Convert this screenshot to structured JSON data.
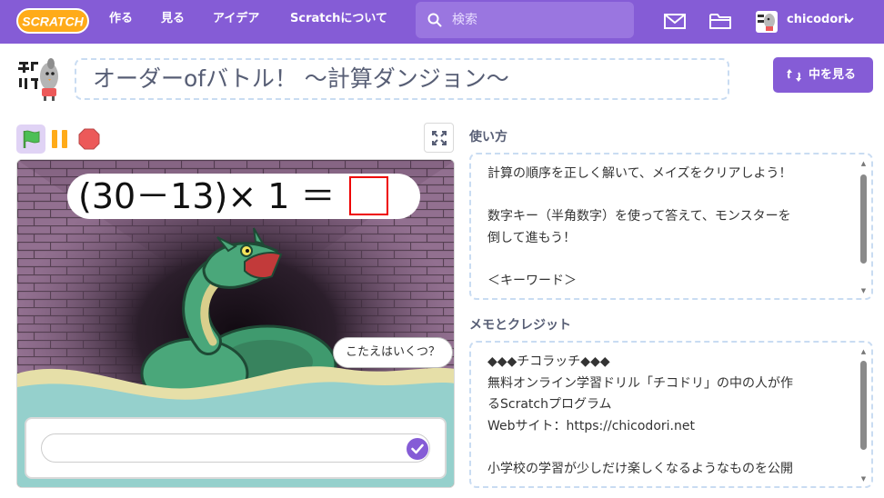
{
  "nav": {
    "logo_text": "SCRATCH",
    "create": "作る",
    "explore": "見る",
    "ideas": "アイデア",
    "about": "Scratchについて",
    "search_placeholder": "検索",
    "user_name": "chicodori",
    "icons": [
      "search-icon",
      "mail-icon",
      "folder-icon",
      "chevron-down-icon"
    ]
  },
  "project": {
    "title": "オーダーofバトル！ ～計算ダンジョン～",
    "see_inside_label": "中を見る",
    "avatar_text": "チコドリ"
  },
  "stage": {
    "equation": "(30－13)× 1 ＝",
    "speech_bubble": "こたえはいくつ？",
    "answer_input_value": ""
  },
  "instructions": {
    "heading": "使い方",
    "text": "計算の順序を正しく解いて、メイズをクリアしよう！\n\n数字キー（半角数字）を使って答えて、モンスターを\n倒して進もう！\n\n＜キーワード＞"
  },
  "notes": {
    "heading": "メモとクレジット",
    "text": "◆◆◆チコラッチ◆◆◆\n無料オンライン学習ドリル「チコドリ」の中の人が作\nるScratchプログラム\nWebサイト：https://chicodori.net\n\n小学校の学習が少しだけ楽しくなるようなものを公開"
  },
  "colors": {
    "brand": "#855cd6",
    "brand_search": "#9a76e0",
    "text": "#575e75",
    "panel_border": "#c9dcf2",
    "flag_green": "#4cbf56",
    "pause_orange": "#ffab19",
    "stop_red": "#ec5959"
  }
}
